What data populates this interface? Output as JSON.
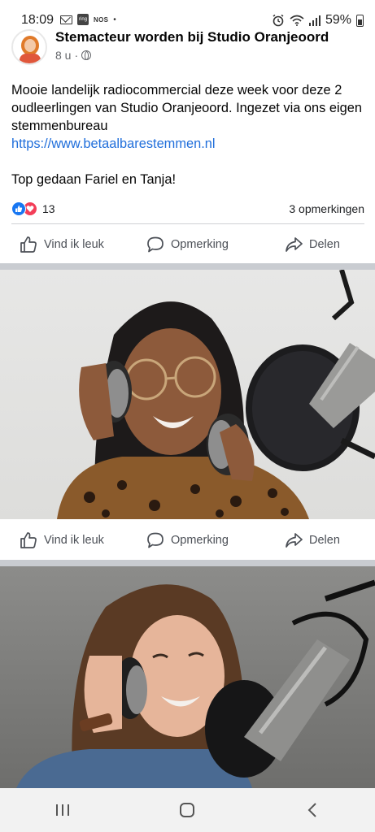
{
  "status_bar": {
    "time": "18:09",
    "nos_label": "NOS",
    "ring_label": "ring",
    "dot": "•",
    "battery": "59%"
  },
  "post": {
    "author": "Stemacteur worden bij Studio Oranjeoord",
    "time": "8 u",
    "time_separator": "·",
    "text": "Mooie landelijk radiocommercial deze week voor deze 2 oudleerlingen van Studio Oranjeoord. Ingezet via ons eigen stemmenbureau",
    "link": "https://www.betaalbarestemmen.nl",
    "sign_off": "Top gedaan Fariel en Tanja!",
    "reaction_count": "13",
    "comment_count": "3 opmerkingen"
  },
  "actions": {
    "like": "Vind ik leuk",
    "comment": "Opmerking",
    "share": "Delen"
  },
  "icons": {
    "like": "thumbs-up-icon",
    "comment": "speech-bubble-icon",
    "share": "share-arrow-icon",
    "privacy": "globe-icon",
    "nav_recent": "recent-apps-icon",
    "nav_home": "home-icon",
    "nav_back": "back-icon"
  },
  "colors": {
    "link": "#216fdb",
    "like_badge": "#1877f2",
    "love_badge": "#f33e58",
    "text_secondary": "#65676b"
  }
}
